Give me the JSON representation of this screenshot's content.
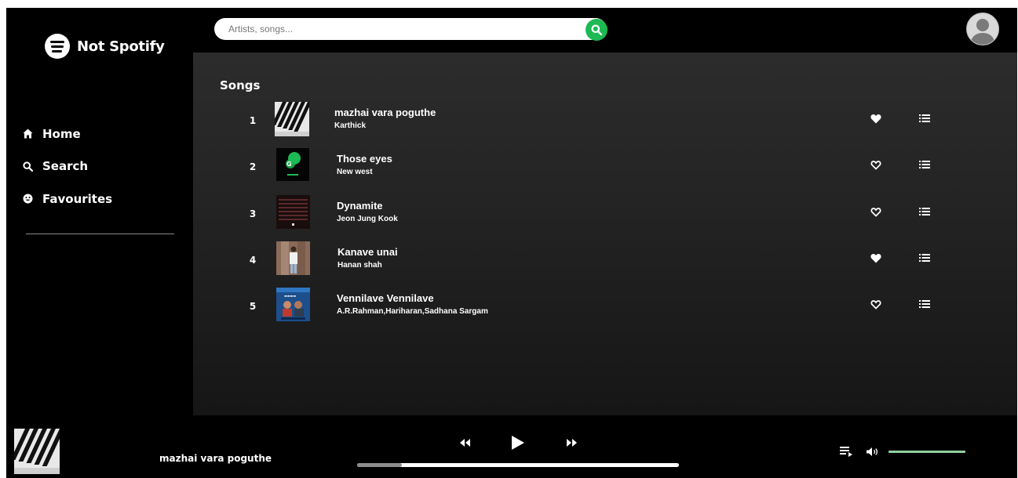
{
  "brand": {
    "name": "Not Spotify",
    "logo_icon": "spotify-logo-icon"
  },
  "nav": [
    {
      "label": "Home",
      "icon": "home-icon"
    },
    {
      "label": "Search",
      "icon": "search-icon"
    },
    {
      "label": "Favourites",
      "icon": "smile-icon"
    }
  ],
  "search": {
    "placeholder": "Artists, songs...",
    "button_icon": "search-icon"
  },
  "user": {
    "avatar_icon": "user-avatar-icon"
  },
  "songs_section": {
    "title": "Songs",
    "songs": [
      {
        "num": "1",
        "title": "mazhai vara poguthe",
        "artist": "Karthick",
        "favourite": true
      },
      {
        "num": "2",
        "title": "Those eyes",
        "artist": "New west",
        "favourite": false
      },
      {
        "num": "3",
        "title": "Dynamite",
        "artist": "Jeon Jung Kook",
        "favourite": false
      },
      {
        "num": "4",
        "title": "Kanave unai",
        "artist": "Hanan shah",
        "favourite": true
      },
      {
        "num": "5",
        "title": "Vennilave Vennilave",
        "artist": "A.R.Rahman,Hariharan,Sadhana Sargam",
        "favourite": false
      }
    ]
  },
  "player": {
    "now_playing_title": "mazhai vara poguthe",
    "progress_fraction": 0.14,
    "volume_fraction": 1.0
  },
  "colors": {
    "accent": "#1db954",
    "volume": "#8fd19e",
    "background": "#000000",
    "panel": "#2c2c2c"
  }
}
